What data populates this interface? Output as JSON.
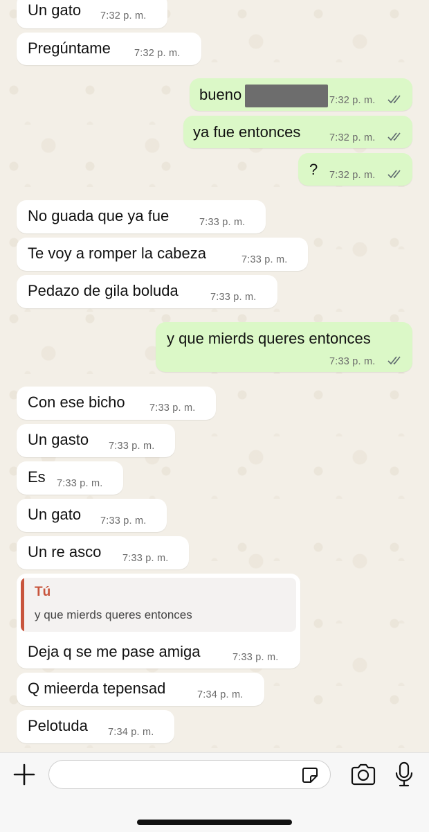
{
  "messages": [
    {
      "dir": "in",
      "text": "Un gato",
      "time": "7:32 p. m."
    },
    {
      "dir": "in",
      "text": "Pregúntame",
      "time": "7:32 p. m."
    },
    {
      "dir": "out",
      "text": "bueno",
      "time": "7:32 p. m.",
      "redacted": true,
      "read": true
    },
    {
      "dir": "out",
      "text": "ya fue entonces",
      "time": "7:32 p. m.",
      "read": true
    },
    {
      "dir": "out",
      "text": "?",
      "time": "7:32 p. m.",
      "read": true
    },
    {
      "dir": "in",
      "text": "No guada que ya fue",
      "time": "7:33 p. m."
    },
    {
      "dir": "in",
      "text": "Te voy a romper la cabeza",
      "time": "7:33 p. m."
    },
    {
      "dir": "in",
      "text": "Pedazo de gila boluda",
      "time": "7:33 p. m."
    },
    {
      "dir": "out",
      "text": "y que mierds queres entonces",
      "time": "7:33 p. m.",
      "read": true
    },
    {
      "dir": "in",
      "text": "Con ese bicho",
      "time": "7:33 p. m."
    },
    {
      "dir": "in",
      "text": "Un gasto",
      "time": "7:33 p. m."
    },
    {
      "dir": "in",
      "text": "Es",
      "time": "7:33 p. m."
    },
    {
      "dir": "in",
      "text": "Un gato",
      "time": "7:33 p. m."
    },
    {
      "dir": "in",
      "text": "Un re asco",
      "time": "7:33 p. m."
    },
    {
      "dir": "in",
      "text": "Deja q se me pase amiga",
      "time": "7:33 p. m.",
      "quote": {
        "author": "Tú",
        "text": "y que mierds queres entonces"
      }
    },
    {
      "dir": "in",
      "text": "Q mieerda tepensad",
      "time": "7:34 p. m."
    },
    {
      "dir": "in",
      "text": "Pelotuda",
      "time": "7:34 p. m."
    }
  ],
  "colors": {
    "incoming_bubble": "#ffffff",
    "outgoing_bubble": "#dbf8c7",
    "quote_accent": "#c8553d",
    "wallpaper": "#f3efe7"
  },
  "input": {
    "value": "",
    "placeholder": ""
  },
  "icons": {
    "attach": "plus-icon",
    "sticker": "sticker-icon",
    "camera": "camera-icon",
    "mic": "microphone-icon"
  }
}
